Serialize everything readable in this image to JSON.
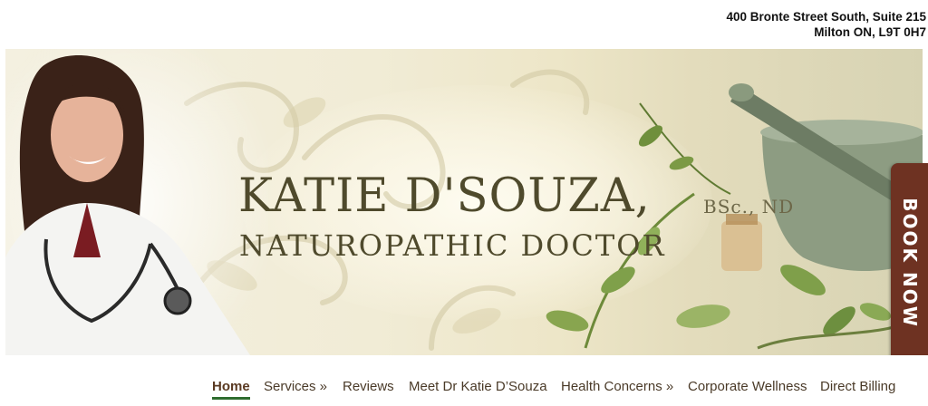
{
  "header": {
    "address_line1": "400 Bronte Street South, Suite 215",
    "address_line2": "Milton ON, L9T 0H7"
  },
  "hero": {
    "name": "KATIE D'SOUZA,",
    "credentials": "BSc., ND",
    "title": "NATUROPATHIC DOCTOR",
    "book_now": "BOOK NOW"
  },
  "nav": {
    "items": [
      {
        "label": "Home"
      },
      {
        "label": "Services »"
      },
      {
        "label": "Reviews"
      },
      {
        "label": "Meet Dr Katie D’Souza"
      },
      {
        "label": "Health Concerns »"
      },
      {
        "label": "Corporate Wellness"
      },
      {
        "label": "Direct Billing"
      }
    ]
  },
  "colors": {
    "book_tab": "#6e3222",
    "nav_active_underline": "#2f6d2f",
    "headline_text": "#4f4a2c"
  }
}
